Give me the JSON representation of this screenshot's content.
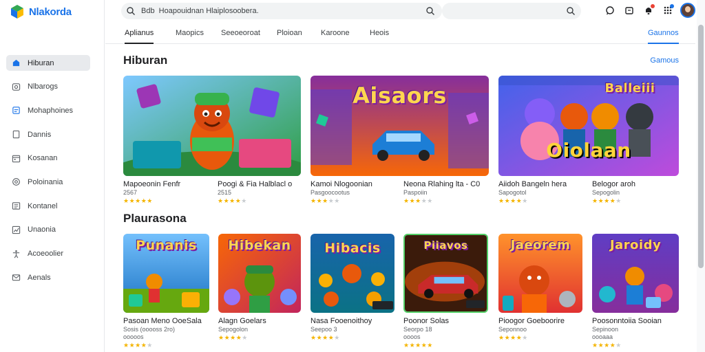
{
  "app": {
    "logo_text": "Nlakorda",
    "logo_icon": "cube-logo-icon"
  },
  "colors": {
    "accent": "#1a73e8",
    "star": "#f4b400",
    "logo_green": "#34a853"
  },
  "search": {
    "value": "Bdb  Hoapouidnan Hlaiplosoobera.",
    "placeholder": "Search"
  },
  "top_icons": [
    "chat-icon",
    "wallet-icon",
    "notifications-icon",
    "apps-grid-icon",
    "avatar"
  ],
  "sidebar": {
    "items": [
      {
        "label": "Hiburan",
        "icon": "home-icon"
      },
      {
        "label": "Nlbarogs",
        "icon": "camera-icon"
      },
      {
        "label": "Mohaphoines",
        "icon": "phone-icon"
      },
      {
        "label": "Dannis",
        "icon": "document-icon"
      },
      {
        "label": "Kosanan",
        "icon": "calendar-icon"
      },
      {
        "label": "Poloinania",
        "icon": "target-icon"
      },
      {
        "label": "Kontanel",
        "icon": "list-icon"
      },
      {
        "label": "Unaonia",
        "icon": "chart-icon"
      },
      {
        "label": "Acoeoolier",
        "icon": "accessibility-icon"
      },
      {
        "label": "Aenals",
        "icon": "mail-icon"
      }
    ]
  },
  "tabs": [
    {
      "label": "Aplianus"
    },
    {
      "label": "Maopics"
    },
    {
      "label": "Seeoeoroat"
    },
    {
      "label": "Ploioan"
    },
    {
      "label": "Karoone"
    },
    {
      "label": "Heois"
    }
  ],
  "tab_right": "Gaunnos",
  "section1": {
    "title": "Hiburan",
    "see_more": "Gamous",
    "cards": [
      {
        "title": "Mapoeonin Fenfr",
        "sub": "2567",
        "rating": 5,
        "art": ""
      },
      {
        "title": "Poogi & Fia Halblacl  o",
        "sub": "2515",
        "rating": 4,
        "art": "Aisaors"
      },
      {
        "title": "Kamoi Nlogoonian",
        "sub": "Pasgoocootus",
        "rating": 3,
        "art": ""
      },
      {
        "title": "Neona Rlahing lta  - C0",
        "sub": "Paspoiin",
        "rating": 3,
        "art": ""
      },
      {
        "title": "Aiidoh Bangeln hera",
        "sub": "Sapogotol",
        "rating": 4,
        "art": "Oiolaan"
      },
      {
        "title": "Belogor aroh",
        "sub": "Sepogolin",
        "rating": 4,
        "art": "Balleiii"
      }
    ]
  },
  "section2": {
    "title": "Plaurasona",
    "cards": [
      {
        "title": "Pasoan Meno OoeSala",
        "sub": "Sosis  (ooooss 2ro)",
        "sub2": "ooooos",
        "rating": 4,
        "art": "Punanis"
      },
      {
        "title": "Alagn Goelars",
        "sub": "Sepogolon",
        "rating": 4,
        "art": "Hibekan"
      },
      {
        "title": "Nasa Fooenoithoy",
        "sub": "Seepoo 3",
        "rating": 4,
        "art": "Hibacis"
      },
      {
        "title": "Poonor Solas",
        "sub": "Seorpo 18",
        "sub2": "oooos",
        "rating": 5,
        "art": "Piiavos"
      },
      {
        "title": "Pioogor Goeboorire",
        "sub": "Seponnoo",
        "rating": 4,
        "art": "Jaeorem"
      },
      {
        "title": "Poosonntoiia Sooian",
        "sub": "Sepinoon",
        "sub2": "oooaaa",
        "rating": 4,
        "art": "Jaroidy"
      }
    ]
  }
}
